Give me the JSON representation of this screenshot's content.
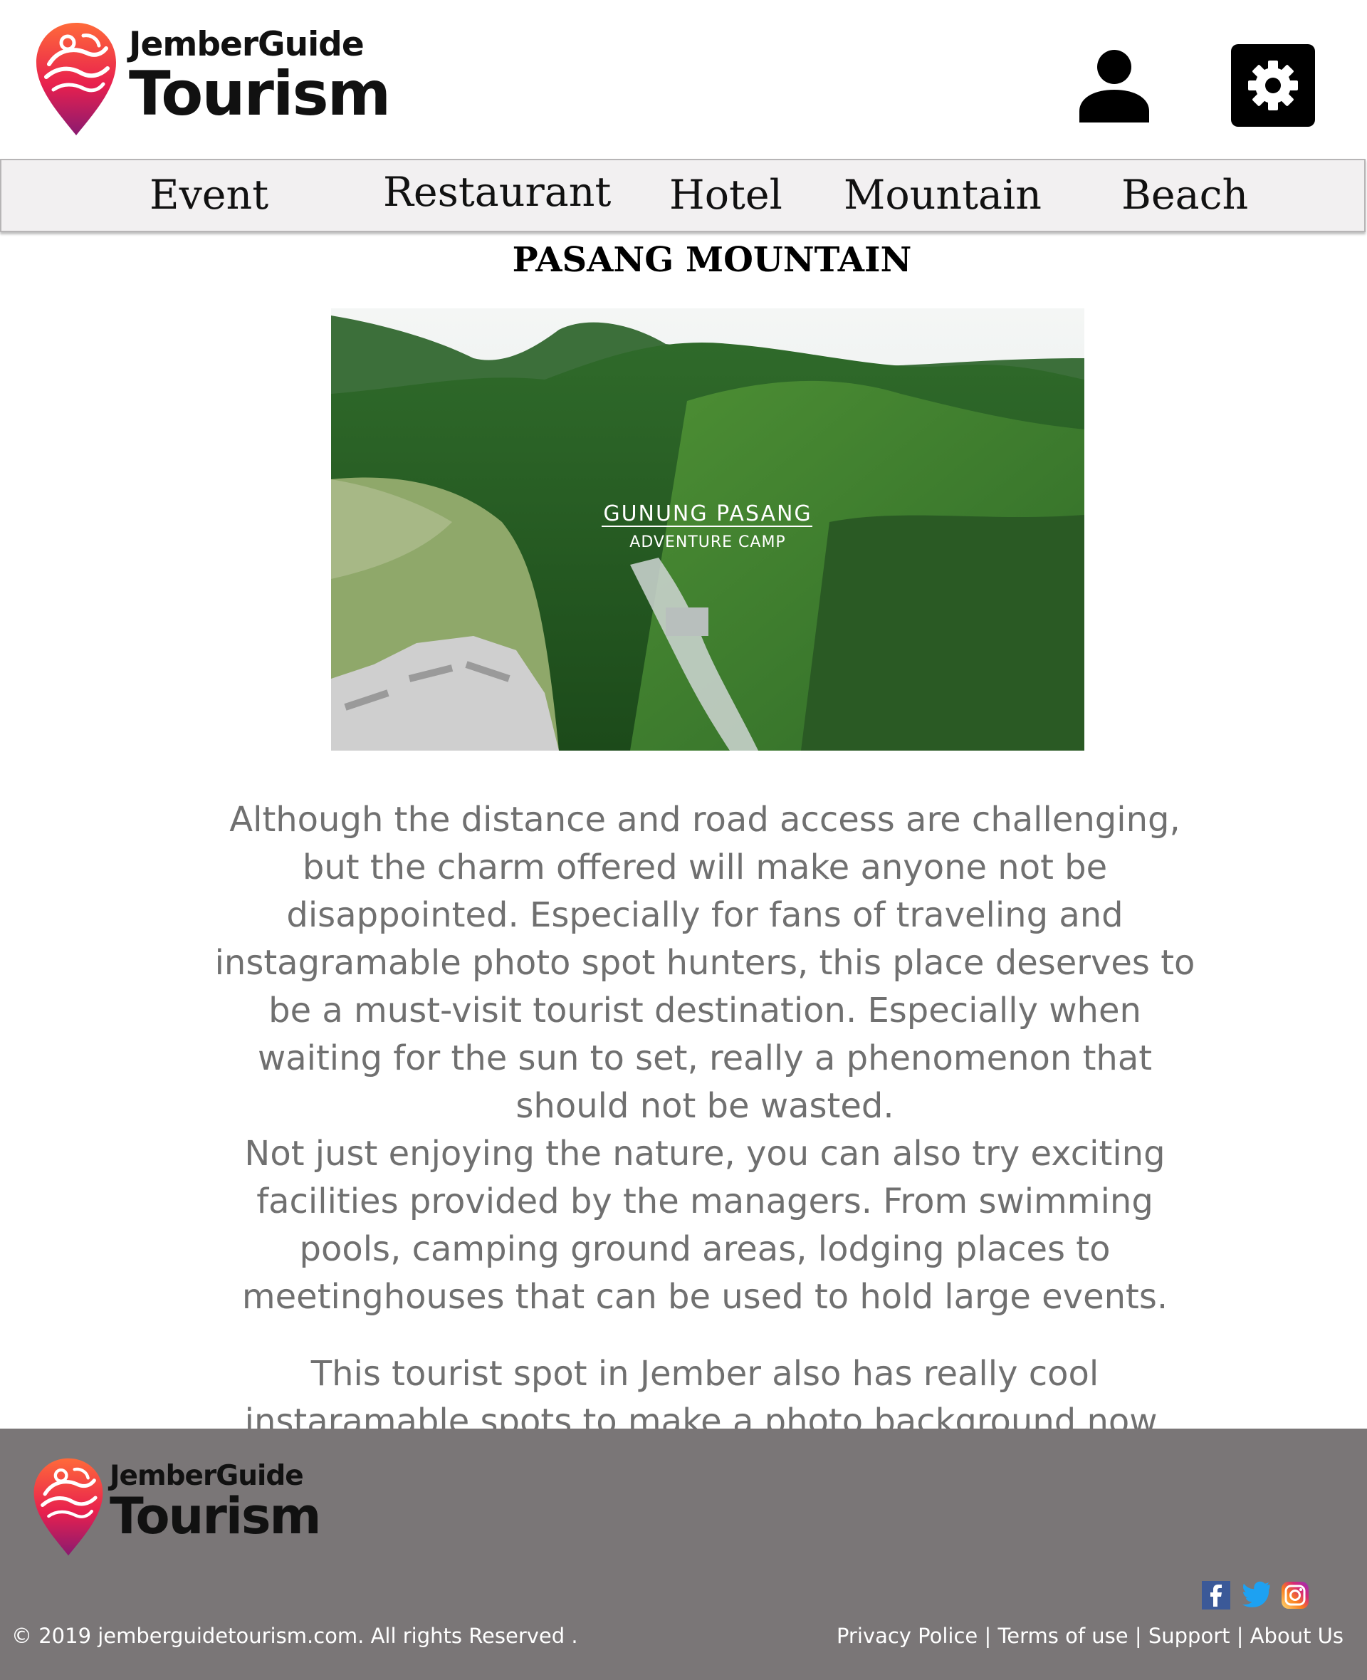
{
  "brand": {
    "line1": "JemberGuide",
    "line2": "Tourism",
    "colors": [
      "#ff5a3c",
      "#e8204e",
      "#8a1a70"
    ]
  },
  "header": {
    "user_icon": "user-icon",
    "settings_icon": "gear-icon"
  },
  "nav": {
    "items": [
      {
        "label": "Event"
      },
      {
        "label": "Restaurant"
      },
      {
        "label": "Hotel"
      },
      {
        "label": "Mountain"
      },
      {
        "label": "Beach"
      }
    ]
  },
  "main": {
    "title": "PASANG MOUNTAIN",
    "image": {
      "overlay_title": "GUNUNG PASANG",
      "overlay_subtitle": "ADVENTURE CAMP"
    },
    "paragraph1": "Although the distance and road access are challenging, but the charm offered will make anyone not be disappointed. Especially for fans of traveling and instagramable photo spot hunters, this place deserves to be a must-visit tourist destination. Especially when waiting for the sun to set, really a phenomenon that should not be wasted.",
    "paragraph2": "Not just enjoying the nature, you can also try exciting facilities provided by the managers. From swimming pools, camping ground areas, lodging places to meetinghouses that can be used to hold large events.",
    "paragraph3": "This tourist spot in Jember also has really cool instaramable spots to make a photo background now."
  },
  "footer": {
    "copyright": "© 2019 jemberguidetourism.com. All rights Reserved .",
    "links": [
      "Privacy Police",
      "Terms of use",
      "Support",
      "About Us"
    ],
    "separator": " | ",
    "social": [
      "facebook-icon",
      "twitter-icon",
      "instagram-icon"
    ],
    "background": "#7a7677"
  }
}
